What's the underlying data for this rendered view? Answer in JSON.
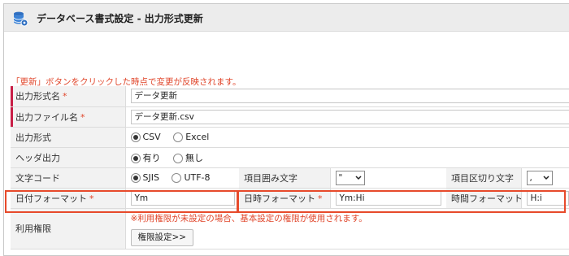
{
  "header": {
    "title": "データベース書式設定 - 出力形式更新",
    "icon": "database-gear-icon"
  },
  "notice": "「更新」ボタンをクリックした時点で変更が反映されます。",
  "colors": {
    "accent_red": "#e74a2b",
    "required_bar": "#c81e46",
    "header_bg": "#ececec",
    "label_bg": "#f2f2f2"
  },
  "form": {
    "output_name": {
      "label": "出力形式名",
      "required": "*",
      "value": "データ更新"
    },
    "output_file": {
      "label": "出力ファイル名",
      "required": "*",
      "value": "データ更新.csv"
    },
    "output_format": {
      "label": "出力形式",
      "options": [
        "CSV",
        "Excel"
      ],
      "selected": "CSV"
    },
    "header_output": {
      "label": "ヘッダ出力",
      "options": [
        "有り",
        "無し"
      ],
      "selected": "有り"
    },
    "charset": {
      "label": "文字コード",
      "options": [
        "SJIS",
        "UTF-8"
      ],
      "selected": "SJIS"
    },
    "quote": {
      "label": "項目囲み文字",
      "value": "\""
    },
    "delimiter": {
      "label": "項目区切り文字",
      "value": ","
    },
    "date_format": {
      "label": "日付フォーマット",
      "required": "*",
      "value": "Ym"
    },
    "datetime_format": {
      "label": "日時フォーマット",
      "required": "*",
      "value": "Ym:Hi"
    },
    "time_format": {
      "label": "時間フォーマット",
      "value": "H:i"
    },
    "permission": {
      "label": "利用権限",
      "note": "※利用権限が未設定の場合、基本設定の権限が使用されます。",
      "button": "権限設定>>"
    }
  }
}
